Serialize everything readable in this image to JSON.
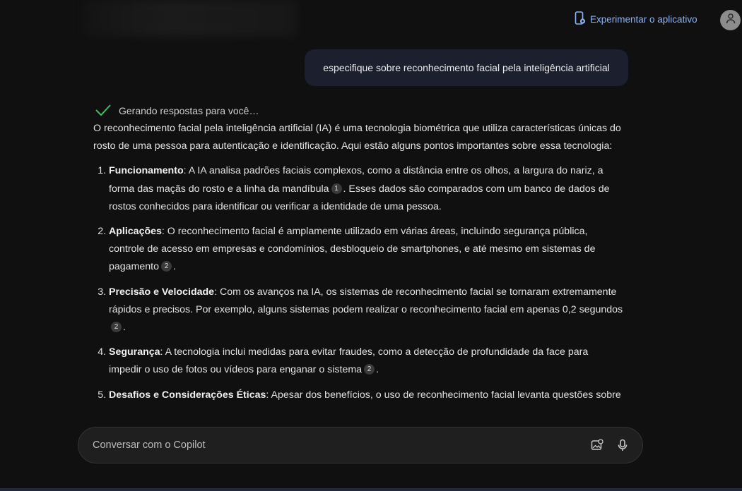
{
  "header": {
    "app_link_label": "Experimentar o aplicativo"
  },
  "chat": {
    "user_message": "especifique sobre reconhecimento facial pela inteligência artificial",
    "status_text": "Gerando respostas para você…",
    "intro": "O reconhecimento facial pela inteligência artificial (IA) é uma tecnologia biométrica que utiliza características únicas do rosto de uma pessoa para autenticação e identificação. Aqui estão alguns pontos importantes sobre essa tecnologia:",
    "items": [
      {
        "title": "Funcionamento",
        "text_a": ": A IA analisa padrões faciais complexos, como a distância entre os olhos, a largura do nariz, a forma das maçãs do rosto e a linha da mandíbula",
        "cite_a": "1",
        "text_b": ". Esses dados são comparados com um banco de dados de rostos conhecidos para identificar ou verificar a identidade de uma pessoa."
      },
      {
        "title": "Aplicações",
        "text_a": ": O reconhecimento facial é amplamente utilizado em várias áreas, incluindo segurança pública, controle de acesso em empresas e condomínios, desbloqueio de smartphones, e até mesmo em sistemas de pagamento",
        "cite_a": "2",
        "text_b": "."
      },
      {
        "title": "Precisão e Velocidade",
        "text_a": ": Com os avanços na IA, os sistemas de reconhecimento facial se tornaram extremamente rápidos e precisos. Por exemplo, alguns sistemas podem realizar o reconhecimento facial em apenas 0,2 segundos",
        "cite_a": "2",
        "text_b": "."
      },
      {
        "title": "Segurança",
        "text_a": ": A tecnologia inclui medidas para evitar fraudes, como a detecção de profundidade da face para impedir o uso de fotos ou vídeos para enganar o sistema",
        "cite_a": "2",
        "text_b": "."
      },
      {
        "title": "Desafios e Considerações Éticas",
        "text_a": ": Apesar dos benefícios, o uso de reconhecimento facial levanta questões sobre",
        "cite_a": "",
        "text_b": ""
      }
    ]
  },
  "composer": {
    "placeholder": "Conversar com o Copilot"
  },
  "icons": {
    "app": "phone-app-icon",
    "avatar": "user-avatar-icon",
    "status": "checkmark-icon",
    "image_search": "image-search-icon",
    "mic": "microphone-icon"
  },
  "colors": {
    "background": "#101010",
    "link": "#8ab4f8",
    "check": "#3fbf5f",
    "user_bubble": "#1c1f2e"
  }
}
